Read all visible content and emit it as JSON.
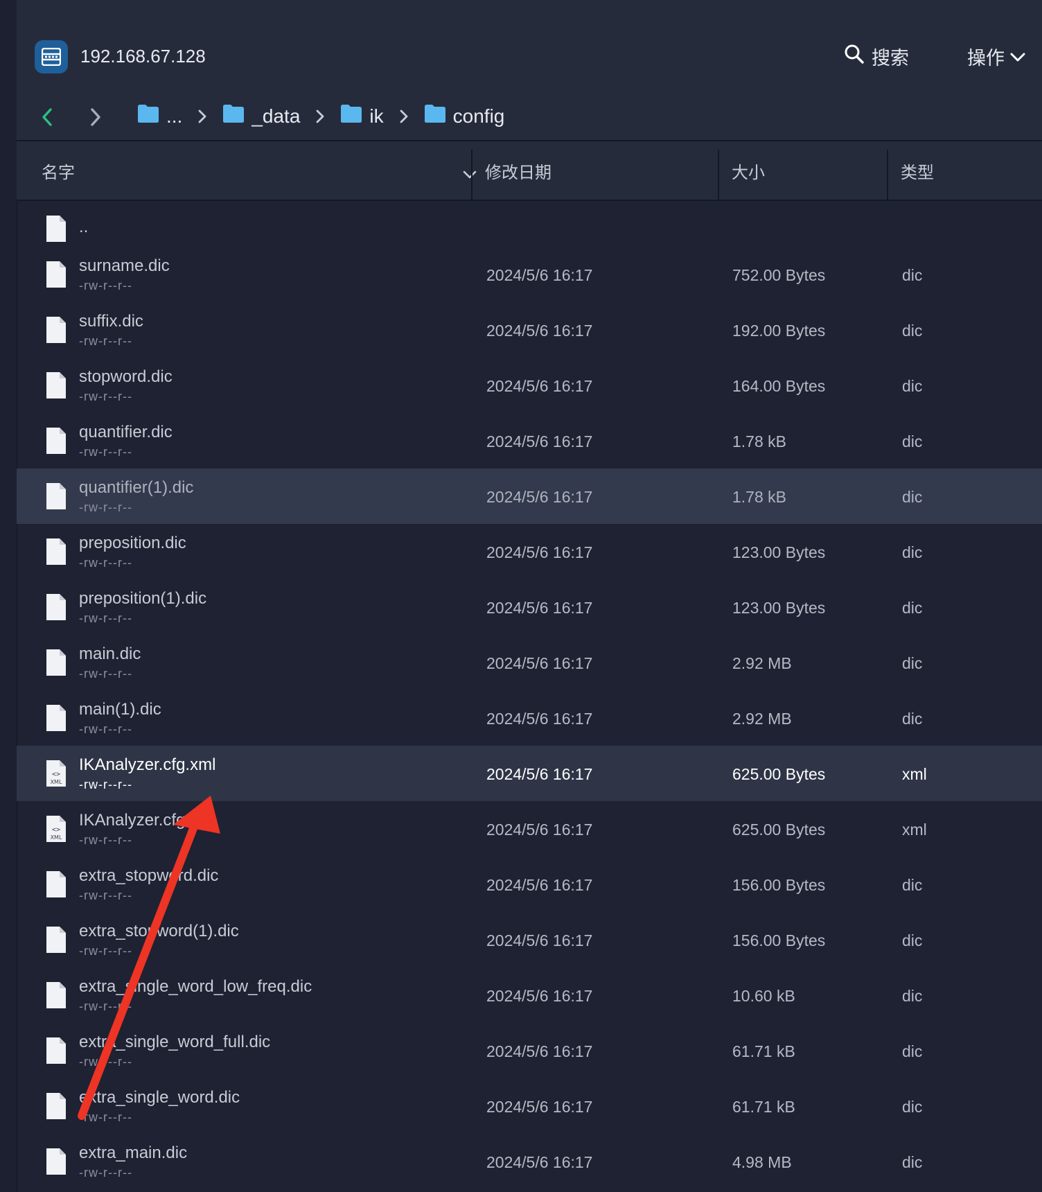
{
  "header": {
    "host": "192.168.67.128",
    "search_label": "搜索",
    "ops_label": "操作"
  },
  "breadcrumb": [
    "...",
    "_data",
    "ik",
    "config"
  ],
  "columns": {
    "name": "名字",
    "modified": "修改日期",
    "size": "大小",
    "type": "类型"
  },
  "files": [
    {
      "name": "..",
      "perm": "",
      "date": "",
      "size": "",
      "type": "",
      "icon": "file-icon"
    },
    {
      "name": "surname.dic",
      "perm": "-rw-r--r--",
      "date": "2024/5/6 16:17",
      "size": "752.00 Bytes",
      "type": "dic",
      "icon": "file-icon"
    },
    {
      "name": "suffix.dic",
      "perm": "-rw-r--r--",
      "date": "2024/5/6 16:17",
      "size": "192.00 Bytes",
      "type": "dic",
      "icon": "file-icon"
    },
    {
      "name": "stopword.dic",
      "perm": "-rw-r--r--",
      "date": "2024/5/6 16:17",
      "size": "164.00 Bytes",
      "type": "dic",
      "icon": "file-icon"
    },
    {
      "name": "quantifier.dic",
      "perm": "-rw-r--r--",
      "date": "2024/5/6 16:17",
      "size": "1.78 kB",
      "type": "dic",
      "icon": "file-icon"
    },
    {
      "name": "quantifier(1).dic",
      "perm": "-rw-r--r--",
      "date": "2024/5/6 16:17",
      "size": "1.78 kB",
      "type": "dic",
      "icon": "file-icon"
    },
    {
      "name": "preposition.dic",
      "perm": "-rw-r--r--",
      "date": "2024/5/6 16:17",
      "size": "123.00 Bytes",
      "type": "dic",
      "icon": "file-icon"
    },
    {
      "name": "preposition(1).dic",
      "perm": "-rw-r--r--",
      "date": "2024/5/6 16:17",
      "size": "123.00 Bytes",
      "type": "dic",
      "icon": "file-icon"
    },
    {
      "name": "main.dic",
      "perm": "-rw-r--r--",
      "date": "2024/5/6 16:17",
      "size": "2.92 MB",
      "type": "dic",
      "icon": "file-icon"
    },
    {
      "name": "main(1).dic",
      "perm": "-rw-r--r--",
      "date": "2024/5/6 16:17",
      "size": "2.92 MB",
      "type": "dic",
      "icon": "file-icon"
    },
    {
      "name": "IKAnalyzer.cfg.xml",
      "perm": "-rw-r--r--",
      "date": "2024/5/6 16:17",
      "size": "625.00 Bytes",
      "type": "xml",
      "icon": "xml-file-icon"
    },
    {
      "name": "IKAnalyzer.cfg.xml",
      "perm": "-rw-r--r--",
      "date": "2024/5/6 16:17",
      "size": "625.00 Bytes",
      "type": "xml",
      "icon": "xml-file-icon"
    },
    {
      "name": "extra_stopword.dic",
      "perm": "-rw-r--r--",
      "date": "2024/5/6 16:17",
      "size": "156.00 Bytes",
      "type": "dic",
      "icon": "file-icon"
    },
    {
      "name": "extra_stopword(1).dic",
      "perm": "-rw-r--r--",
      "date": "2024/5/6 16:17",
      "size": "156.00 Bytes",
      "type": "dic",
      "icon": "file-icon"
    },
    {
      "name": "extra_single_word_low_freq.dic",
      "perm": "-rw-r--r--",
      "date": "2024/5/6 16:17",
      "size": "10.60 kB",
      "type": "dic",
      "icon": "file-icon"
    },
    {
      "name": "extra_single_word_full.dic",
      "perm": "-rw-r--r--",
      "date": "2024/5/6 16:17",
      "size": "61.71 kB",
      "type": "dic",
      "icon": "file-icon"
    },
    {
      "name": "extra_single_word.dic",
      "perm": "-rw-r--r--",
      "date": "2024/5/6 16:17",
      "size": "61.71 kB",
      "type": "dic",
      "icon": "file-icon"
    },
    {
      "name": "extra_main.dic",
      "perm": "-rw-r--r--",
      "date": "2024/5/6 16:17",
      "size": "4.98 MB",
      "type": "dic",
      "icon": "file-icon"
    }
  ],
  "hover_index": 5,
  "selected_index": 10,
  "colors": {
    "background": "#1e2232",
    "toolbar": "#262b3c",
    "accent_green": "#27c281",
    "folder_blue": "#5ab8ef",
    "annotation_arrow": "#ee3424"
  }
}
